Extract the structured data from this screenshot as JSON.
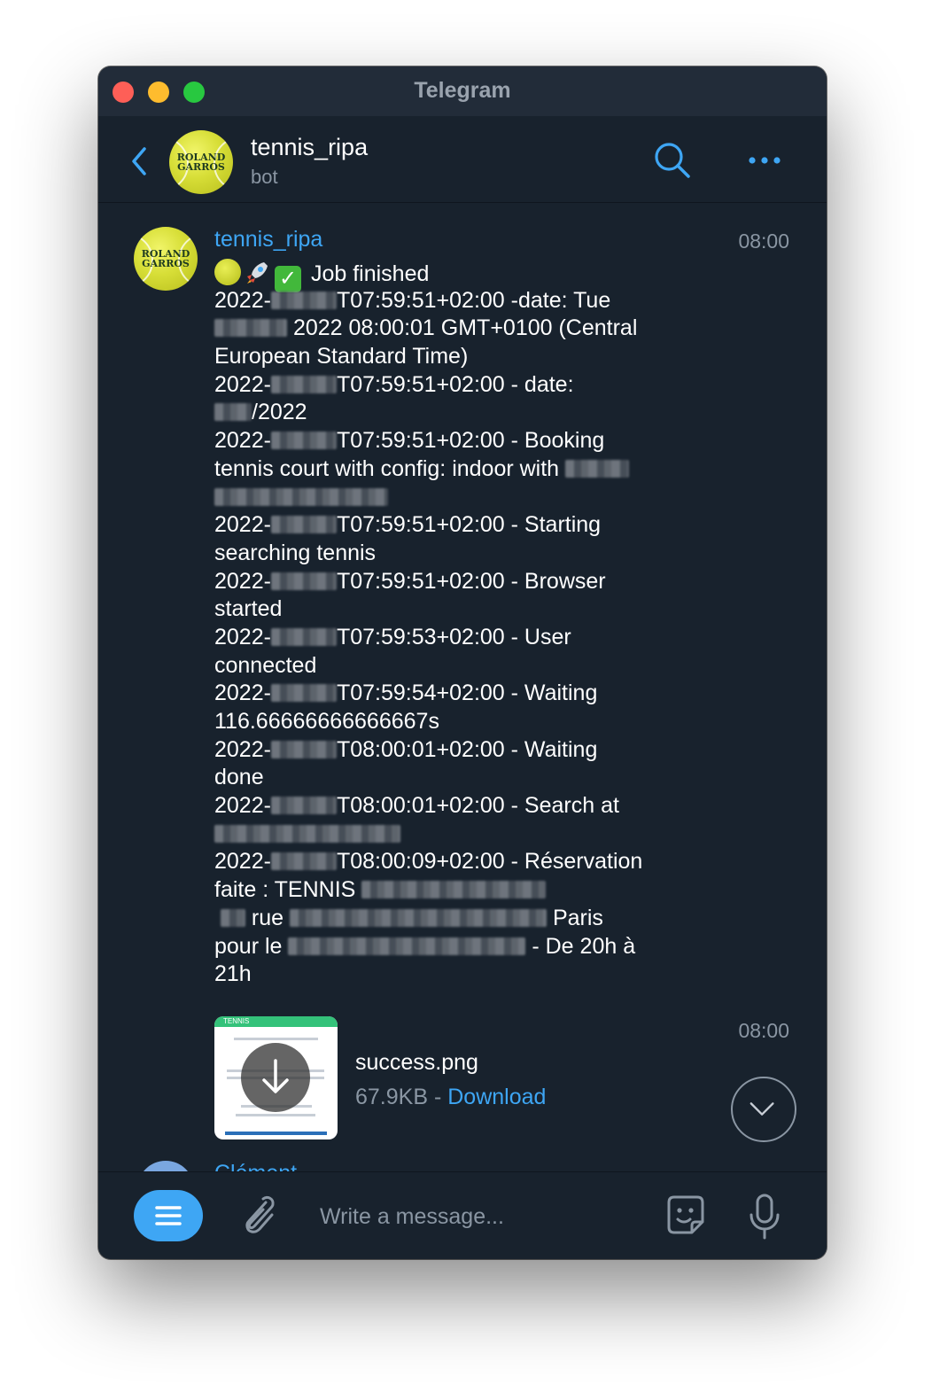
{
  "window": {
    "title": "Telegram"
  },
  "header": {
    "name": "tennis_ripa",
    "status": "bot"
  },
  "avatar": {
    "logo_line1": "ROLAND",
    "logo_line2": "GARROS"
  },
  "message": {
    "sender": "tennis_ripa",
    "time": "08:00",
    "lines": [
      "Job finished",
      "2022-",
      "T07:59:51+02:00 -date: Tue",
      "2022 08:00:01 GMT+0100 (Central",
      "European Standard Time)",
      "2022-",
      "T07:59:51+02:00 - date:",
      "/2022",
      "2022-",
      "T07:59:51+02:00 - Booking",
      "tennis court with config: indoor with",
      "2022-",
      "T07:59:51+02:00 - Starting",
      "searching tennis",
      "2022-",
      "T07:59:51+02:00 - Browser",
      "started",
      "2022-",
      "T07:59:53+02:00 - User",
      "connected",
      "2022-",
      "T07:59:54+02:00 - Waiting",
      "116.66666666666667s",
      "2022-",
      "T08:00:01+02:00 - Waiting",
      "done",
      "2022-",
      "T08:00:01+02:00 - Search at",
      "2022-",
      "T08:00:09+02:00 - Réservation",
      "faite : TENNIS",
      "rue",
      "Paris",
      "pour le",
      "- De 20h à",
      "21h"
    ]
  },
  "file": {
    "time": "08:00",
    "name": "success.png",
    "size": "67.9KB",
    "separator": "-",
    "download_label": "Download",
    "thumb_header": "TENNIS"
  },
  "next_message": {
    "sender": "Clément"
  },
  "composer": {
    "placeholder": "Write a message..."
  },
  "colors": {
    "accent": "#3ea6f4",
    "background": "#18222d",
    "muted": "#8a96a3"
  }
}
